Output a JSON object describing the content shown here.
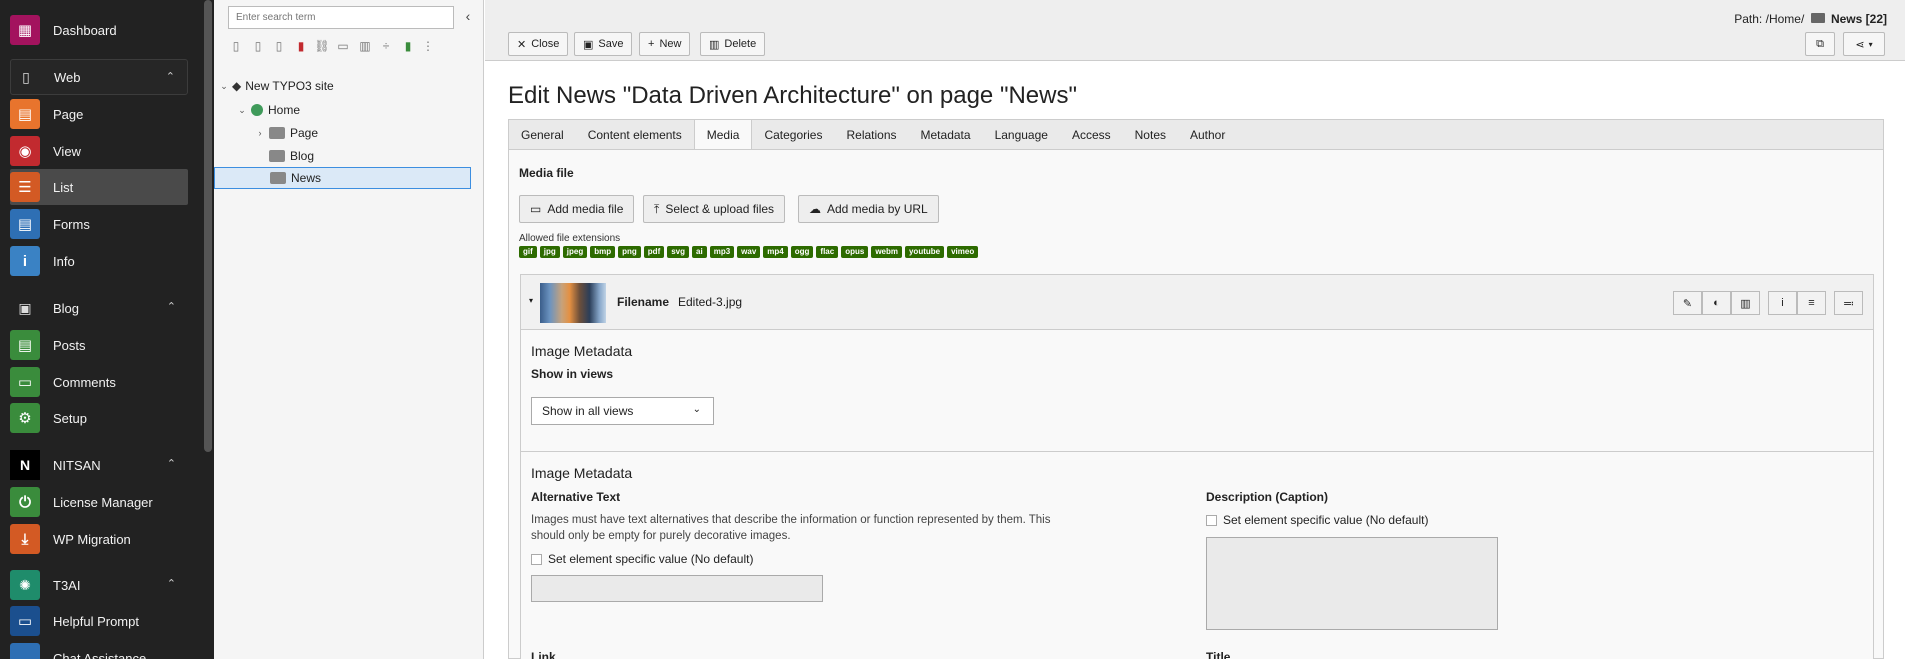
{
  "module_menu": {
    "items": [
      {
        "label": "Dashboard",
        "icon": "dashboard-icon",
        "color": "#a3135e"
      },
      {
        "label": "Web",
        "icon": "page-icon",
        "group": true
      },
      {
        "label": "Page",
        "icon": "page-module-icon",
        "color": "#e8742d"
      },
      {
        "label": "View",
        "icon": "eye-icon",
        "color": "#c22a2f"
      },
      {
        "label": "List",
        "icon": "list-icon",
        "color": "#d35a24",
        "active": true
      },
      {
        "label": "Forms",
        "icon": "forms-icon",
        "color": "#2e6fb4"
      },
      {
        "label": "Info",
        "icon": "info-icon",
        "color": "#3a82c4"
      },
      {
        "label": "Blog",
        "icon": "blog-icon",
        "group": true
      },
      {
        "label": "Posts",
        "icon": "posts-icon",
        "color": "#3a8c3c"
      },
      {
        "label": "Comments",
        "icon": "comments-icon",
        "color": "#3a8c3c"
      },
      {
        "label": "Setup",
        "icon": "gear-icon",
        "color": "#3a8c3c"
      },
      {
        "label": "NITSAN",
        "icon": "nitsan-logo-icon",
        "group": true
      },
      {
        "label": "License Manager",
        "icon": "power-icon",
        "color": "#3a8c3c"
      },
      {
        "label": "WP Migration",
        "icon": "migration-icon",
        "color": "#d35a24"
      },
      {
        "label": "T3AI",
        "icon": "ai-icon",
        "group": true,
        "color": "#1f8c6b"
      },
      {
        "label": "Helpful Prompt",
        "icon": "prompt-icon",
        "color": "#1b4f8e"
      },
      {
        "label": "Chat Assistance",
        "icon": "chat-icon",
        "color": "#2e6fb4"
      }
    ]
  },
  "tree": {
    "search_placeholder": "Enter search term",
    "nodes": [
      {
        "label": "New TYPO3 site"
      },
      {
        "label": "Home"
      },
      {
        "label": "Page"
      },
      {
        "label": "Blog"
      },
      {
        "label": "News"
      }
    ]
  },
  "docheader": {
    "path_label": "Path: /Home/",
    "path_current": "News [22]",
    "buttons": {
      "close": "Close",
      "save": "Save",
      "new": "New",
      "delete": "Delete"
    }
  },
  "title": "Edit News \"Data Driven Architecture\" on page \"News\"",
  "tabs": [
    "General",
    "Content elements",
    "Media",
    "Categories",
    "Relations",
    "Metadata",
    "Language",
    "Access",
    "Notes",
    "Author"
  ],
  "active_tab": "Media",
  "media": {
    "heading": "Media file",
    "add_media": "Add media file",
    "select_upload": "Select & upload files",
    "add_by_url": "Add media by URL",
    "allowed_label": "Allowed file extensions",
    "extensions": [
      "gif",
      "jpg",
      "jpeg",
      "bmp",
      "png",
      "pdf",
      "svg",
      "ai",
      "mp3",
      "wav",
      "mp4",
      "ogg",
      "flac",
      "opus",
      "webm",
      "youtube",
      "vimeo"
    ],
    "extension_color": "#2d6b00"
  },
  "file": {
    "filename_label": "Filename",
    "filename_value": "Edited-3.jpg",
    "meta1_title": "Image Metadata",
    "show_in_views_label": "Show in views",
    "show_in_views_value": "Show in all views",
    "meta2_title": "Image Metadata",
    "alt_label": "Alternative Text",
    "alt_help": "Images must have text alternatives that describe the information or function represented by them. This should only be empty for purely decorative images.",
    "alt_checkbox": "Set element specific value (No default)",
    "desc_label": "Description (Caption)",
    "desc_checkbox": "Set element specific value (No default)",
    "link_label": "Link",
    "title_label": "Title"
  }
}
